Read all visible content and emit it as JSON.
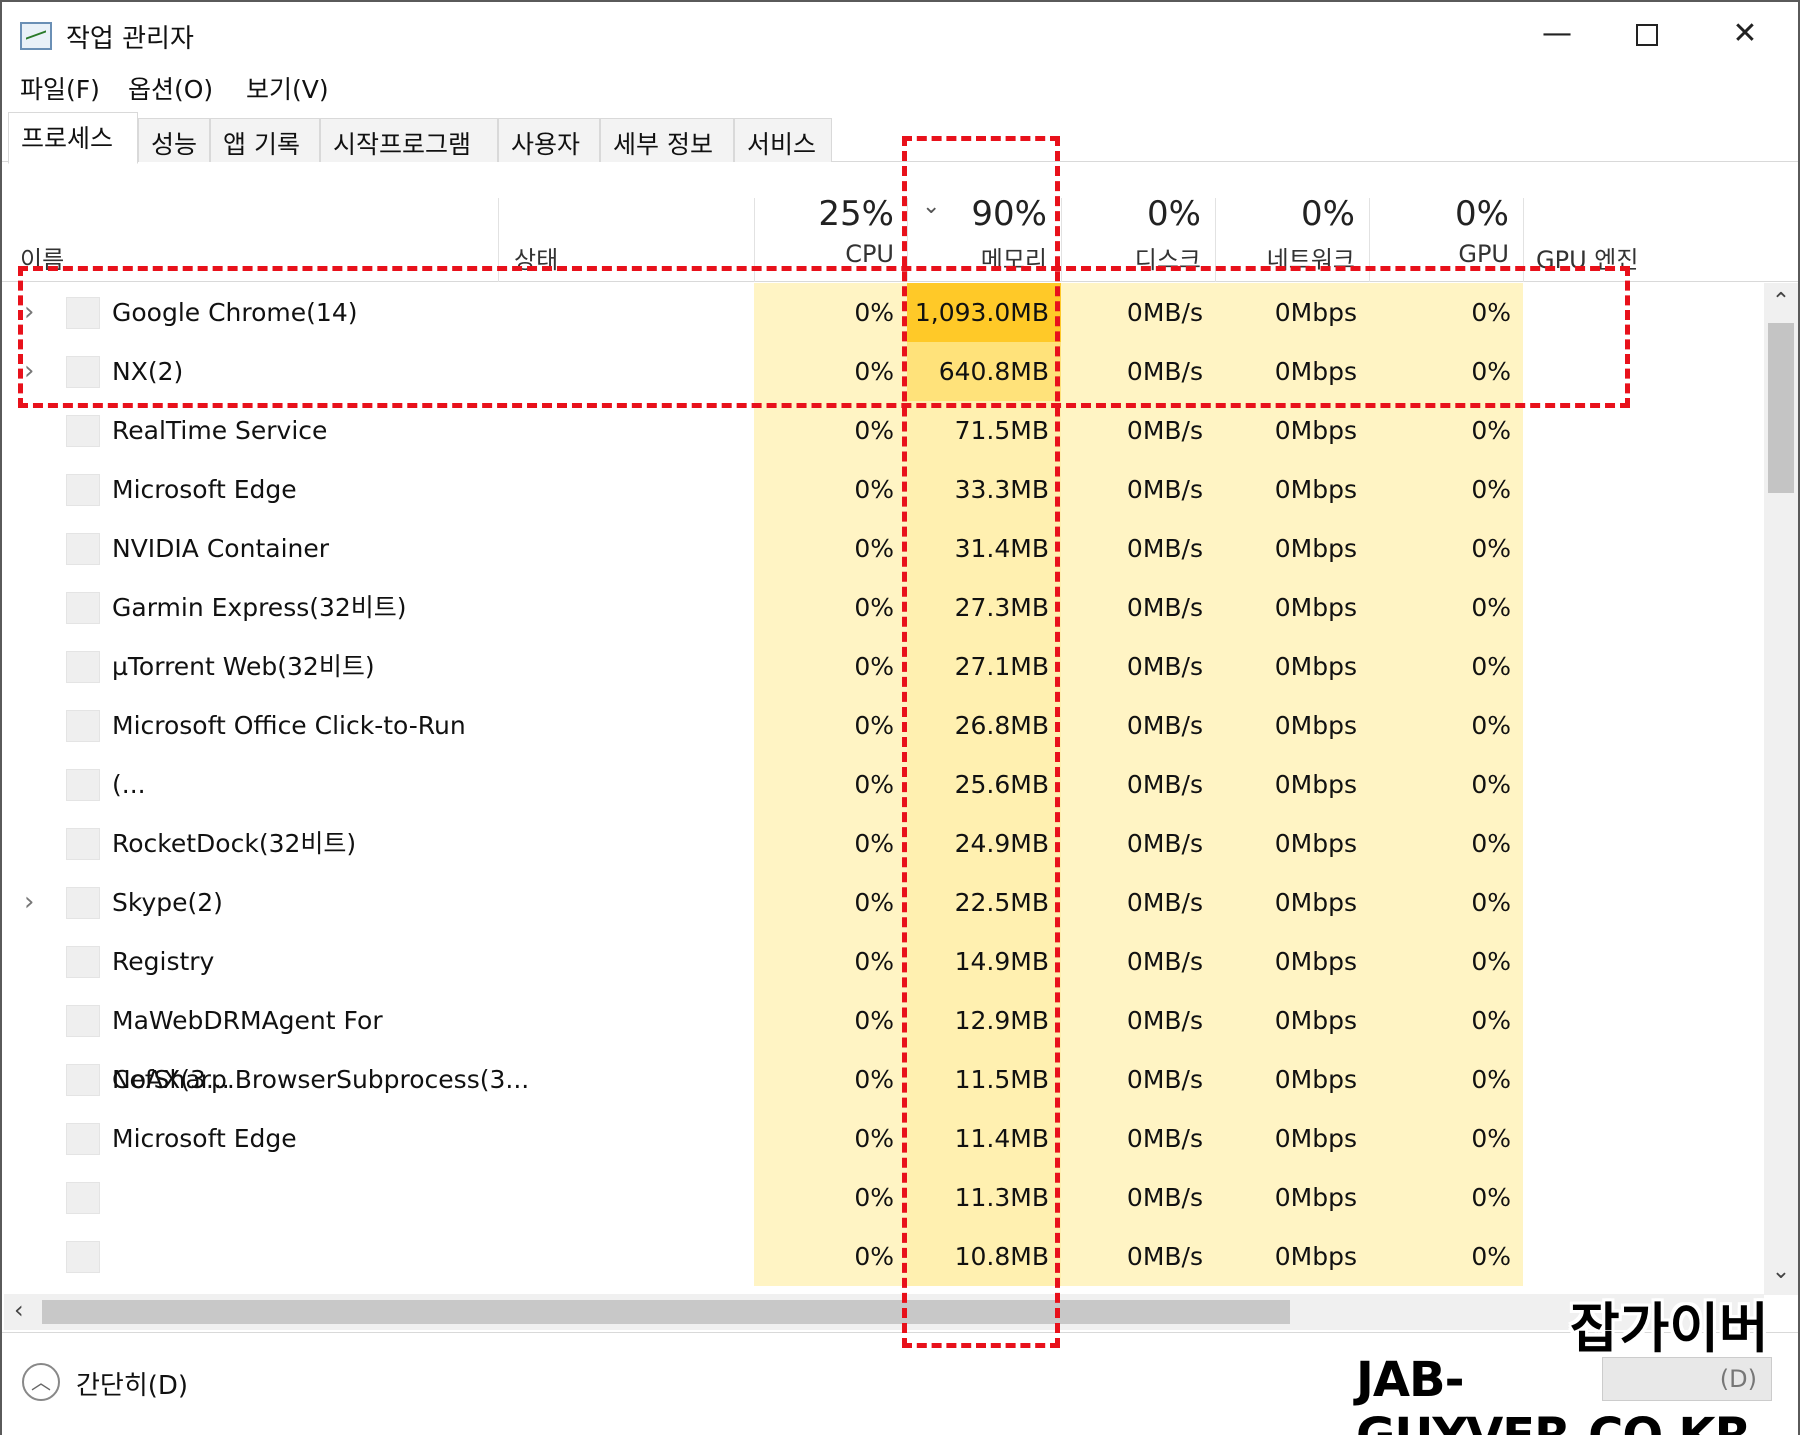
{
  "window": {
    "title": "작업 관리자",
    "icon": "task-manager-icon",
    "controls": {
      "minimize": "—",
      "close": "✕"
    }
  },
  "menu": [
    "파일(F)",
    "옵션(O)",
    "보기(V)"
  ],
  "tabs": [
    "프로세스",
    "성능",
    "앱 기록",
    "시작프로그램",
    "사용자",
    "세부 정보",
    "서비스"
  ],
  "active_tab": "프로세스",
  "columns": {
    "name": {
      "label": "이름"
    },
    "status": {
      "label": "상태"
    },
    "cpu": {
      "label": "CPU",
      "usage": "25%"
    },
    "memory": {
      "label": "메모리",
      "usage": "90%",
      "sorted": true,
      "sort_icon": "chevron-down-icon"
    },
    "disk": {
      "label": "디스크",
      "usage": "0%"
    },
    "network": {
      "label": "네트워크",
      "usage": "0%"
    },
    "gpu": {
      "label": "GPU",
      "usage": "0%"
    },
    "gpu_engine": {
      "label": "GPU 엔진"
    }
  },
  "processes": [
    {
      "name": "Google Chrome(14)",
      "expandable": true,
      "cpu": "0%",
      "memory": "1,093.0MB",
      "disk": "0MB/s",
      "network": "0Mbps",
      "gpu": "0%",
      "mem_level": 3
    },
    {
      "name": "NX(2)",
      "expandable": true,
      "cpu": "0%",
      "memory": "640.8MB",
      "disk": "0MB/s",
      "network": "0Mbps",
      "gpu": "0%",
      "mem_level": 2
    },
    {
      "name": "RealTime Service",
      "expandable": false,
      "cpu": "0%",
      "memory": "71.5MB",
      "disk": "0MB/s",
      "network": "0Mbps",
      "gpu": "0%",
      "mem_level": 1
    },
    {
      "name": "Microsoft Edge",
      "expandable": false,
      "cpu": "0%",
      "memory": "33.3MB",
      "disk": "0MB/s",
      "network": "0Mbps",
      "gpu": "0%",
      "mem_level": 1
    },
    {
      "name": "NVIDIA Container",
      "expandable": false,
      "cpu": "0%",
      "memory": "31.4MB",
      "disk": "0MB/s",
      "network": "0Mbps",
      "gpu": "0%",
      "mem_level": 1
    },
    {
      "name": "Garmin Express(32비트)",
      "expandable": false,
      "cpu": "0%",
      "memory": "27.3MB",
      "disk": "0MB/s",
      "network": "0Mbps",
      "gpu": "0%",
      "mem_level": 1
    },
    {
      "name": "µTorrent Web(32비트)",
      "expandable": false,
      "cpu": "0%",
      "memory": "27.1MB",
      "disk": "0MB/s",
      "network": "0Mbps",
      "gpu": "0%",
      "mem_level": 1
    },
    {
      "name": "Microsoft Office Click-to-Run (...",
      "expandable": false,
      "cpu": "0%",
      "memory": "26.8MB",
      "disk": "0MB/s",
      "network": "0Mbps",
      "gpu": "0%",
      "mem_level": 1
    },
    {
      "name": "",
      "expandable": false,
      "cpu": "0%",
      "memory": "25.6MB",
      "disk": "0MB/s",
      "network": "0Mbps",
      "gpu": "0%",
      "mem_level": 1
    },
    {
      "name": "RocketDock(32비트)",
      "expandable": false,
      "cpu": "0%",
      "memory": "24.9MB",
      "disk": "0MB/s",
      "network": "0Mbps",
      "gpu": "0%",
      "mem_level": 1
    },
    {
      "name": "Skype(2)",
      "expandable": true,
      "cpu": "0%",
      "memory": "22.5MB",
      "disk": "0MB/s",
      "network": "0Mbps",
      "gpu": "0%",
      "mem_level": 1
    },
    {
      "name": "Registry",
      "expandable": false,
      "cpu": "0%",
      "memory": "14.9MB",
      "disk": "0MB/s",
      "network": "0Mbps",
      "gpu": "0%",
      "mem_level": 1
    },
    {
      "name": "MaWebDRMAgent For NoAX(3...",
      "expandable": false,
      "cpu": "0%",
      "memory": "12.9MB",
      "disk": "0MB/s",
      "network": "0Mbps",
      "gpu": "0%",
      "mem_level": 1
    },
    {
      "name": "CefSharp.BrowserSubprocess(3...",
      "expandable": false,
      "cpu": "0%",
      "memory": "11.5MB",
      "disk": "0MB/s",
      "network": "0Mbps",
      "gpu": "0%",
      "mem_level": 1
    },
    {
      "name": "Microsoft Edge",
      "expandable": false,
      "cpu": "0%",
      "memory": "11.4MB",
      "disk": "0MB/s",
      "network": "0Mbps",
      "gpu": "0%",
      "mem_level": 1
    },
    {
      "name": "",
      "expandable": false,
      "cpu": "0%",
      "memory": "11.3MB",
      "disk": "0MB/s",
      "network": "0Mbps",
      "gpu": "0%",
      "mem_level": 1
    },
    {
      "name": "",
      "expandable": false,
      "cpu": "0%",
      "memory": "10.8MB",
      "disk": "0MB/s",
      "network": "0Mbps",
      "gpu": "0%",
      "mem_level": 1
    }
  ],
  "memory_heat_colors": {
    "1": "#fff0b0",
    "2": "#ffe27a",
    "3": "#ffc928"
  },
  "highlight_color": "#e8111b",
  "footer": {
    "fewer_details": "간단히(D)",
    "end_task": "(D)"
  },
  "watermark": {
    "korean": "잡가이버",
    "english": "JAB-GUYVER.CO.KR"
  }
}
